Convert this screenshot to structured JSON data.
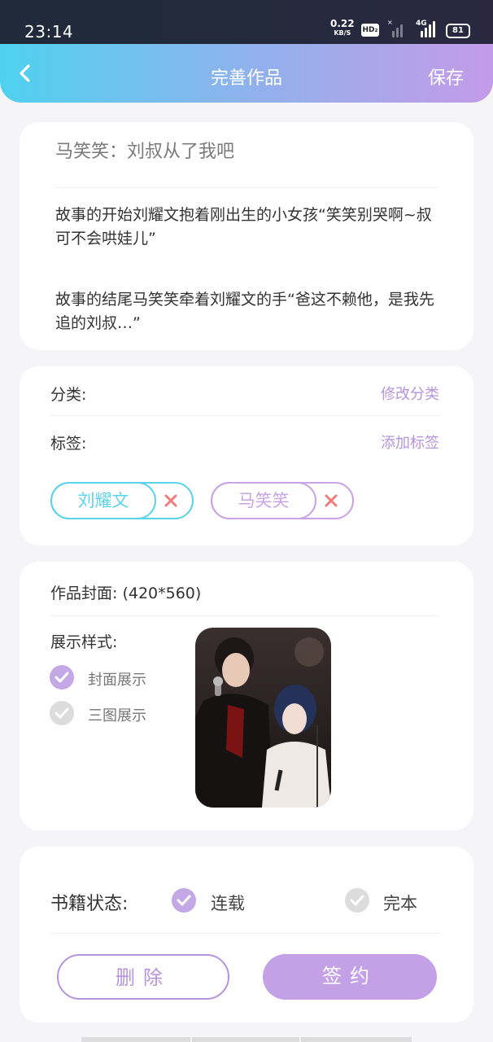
{
  "status_bar": {
    "time": "23:14",
    "net_speed": "0.22",
    "net_unit": "KB/S",
    "hd_label": "HD₂",
    "network_type": "4G",
    "battery": "81"
  },
  "header": {
    "title": "完善作品",
    "save_label": "保存",
    "back_icon": "chevron-left-icon"
  },
  "book": {
    "title": "马笑笑：刘叔从了我吧",
    "desc_start": "故事的开始刘耀文抱着刚出生的小女孩“笑笑别哭啊~叔可不会哄娃儿”",
    "desc_end": "故事的结尾马笑笑牵着刘耀文的手“爸这不赖他，是我先追的刘叔…”"
  },
  "classification": {
    "category_label": "分类:",
    "modify_category": "修改分类",
    "tags_label": "标签:",
    "add_tag": "添加标签",
    "tags": [
      {
        "name": "刘耀文",
        "color": "#5cd3ec"
      },
      {
        "name": "马笑笑",
        "color": "#c9a3e6"
      }
    ],
    "remove_color": "#f07b7b"
  },
  "cover": {
    "label": "作品封面:",
    "size": "(420*560)",
    "display_style_label": "展示样式:",
    "options": [
      {
        "label": "封面展示",
        "checked": true
      },
      {
        "label": "三图展示",
        "checked": false
      }
    ]
  },
  "status": {
    "label": "书籍状态:",
    "options": [
      {
        "label": "连载",
        "checked": true
      },
      {
        "label": "完本",
        "checked": false
      }
    ]
  },
  "actions": {
    "delete_label": "删除",
    "sign_label": "签约"
  },
  "colors": {
    "accent_purple": "#b693de",
    "accent_cyan": "#4fd1ef",
    "check_active": "#c4a8e6",
    "check_inactive": "#dcdcdc"
  }
}
